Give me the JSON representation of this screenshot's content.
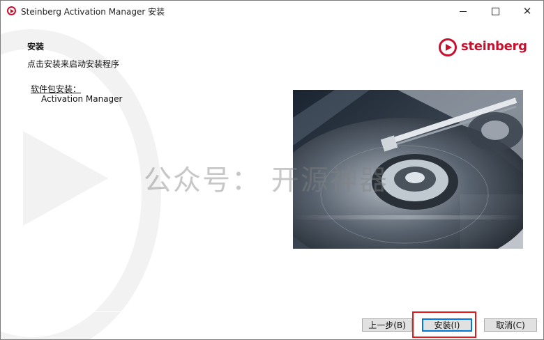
{
  "window": {
    "title": "Steinberg Activation Manager 安装",
    "controls": [
      "minimize",
      "maximize",
      "close"
    ]
  },
  "header": {
    "heading": "安装",
    "subtitle": "点击安装来启动安装程序",
    "logo_text": "steinberg",
    "brand_color": "#c8102e"
  },
  "packages": {
    "label": "软件包安装：",
    "items": [
      "Activation Manager"
    ]
  },
  "overlay_watermark": "公众号： 开源神器",
  "buttons": {
    "back": "上一步(B)",
    "install": "安装(I)",
    "cancel": "取消(C)"
  },
  "icons": {
    "app": "steinberg-play-icon",
    "minimize": "minimize-icon",
    "maximize": "maximize-icon",
    "close": "close-icon"
  }
}
